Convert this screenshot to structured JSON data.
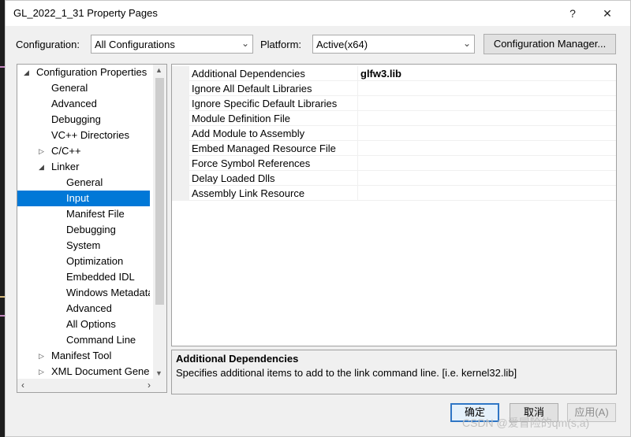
{
  "window": {
    "title": "GL_2022_1_31 Property Pages",
    "help_glyph": "?",
    "close_glyph": "✕"
  },
  "config_bar": {
    "configuration_label": "Configuration:",
    "configuration_value": "All Configurations",
    "platform_label": "Platform:",
    "platform_value": "Active(x64)",
    "manager_button": "Configuration Manager..."
  },
  "tree": {
    "items": [
      {
        "label": "Configuration Properties",
        "level": 0,
        "expander": "expanded"
      },
      {
        "label": "General",
        "level": 1,
        "expander": "none"
      },
      {
        "label": "Advanced",
        "level": 1,
        "expander": "none"
      },
      {
        "label": "Debugging",
        "level": 1,
        "expander": "none"
      },
      {
        "label": "VC++ Directories",
        "level": 1,
        "expander": "none"
      },
      {
        "label": "C/C++",
        "level": 1,
        "expander": "collapsed"
      },
      {
        "label": "Linker",
        "level": 1,
        "expander": "expanded"
      },
      {
        "label": "General",
        "level": 2,
        "expander": "none"
      },
      {
        "label": "Input",
        "level": 2,
        "expander": "none",
        "selected": true
      },
      {
        "label": "Manifest File",
        "level": 2,
        "expander": "none"
      },
      {
        "label": "Debugging",
        "level": 2,
        "expander": "none"
      },
      {
        "label": "System",
        "level": 2,
        "expander": "none"
      },
      {
        "label": "Optimization",
        "level": 2,
        "expander": "none"
      },
      {
        "label": "Embedded IDL",
        "level": 2,
        "expander": "none"
      },
      {
        "label": "Windows Metadata",
        "level": 2,
        "expander": "none"
      },
      {
        "label": "Advanced",
        "level": 2,
        "expander": "none"
      },
      {
        "label": "All Options",
        "level": 2,
        "expander": "none"
      },
      {
        "label": "Command Line",
        "level": 2,
        "expander": "none"
      },
      {
        "label": "Manifest Tool",
        "level": 1,
        "expander": "collapsed"
      },
      {
        "label": "XML Document Generator",
        "level": 1,
        "expander": "collapsed"
      }
    ]
  },
  "properties": {
    "rows": [
      {
        "name": "Additional Dependencies",
        "value": "glfw3.lib"
      },
      {
        "name": "Ignore All Default Libraries",
        "value": ""
      },
      {
        "name": "Ignore Specific Default Libraries",
        "value": ""
      },
      {
        "name": "Module Definition File",
        "value": ""
      },
      {
        "name": "Add Module to Assembly",
        "value": ""
      },
      {
        "name": "Embed Managed Resource File",
        "value": ""
      },
      {
        "name": "Force Symbol References",
        "value": ""
      },
      {
        "name": "Delay Loaded Dlls",
        "value": ""
      },
      {
        "name": "Assembly Link Resource",
        "value": ""
      }
    ]
  },
  "description": {
    "title": "Additional Dependencies",
    "text": "Specifies additional items to add to the link command line. [i.e. kernel32.lib]"
  },
  "buttons": {
    "ok": "确定",
    "cancel": "取消",
    "apply": "应用(A)"
  },
  "watermark": "CSDN @爱冒险的qm(s,a)",
  "colors": {
    "selection": "#0078d7",
    "default_button_border": "#2f76c5"
  }
}
